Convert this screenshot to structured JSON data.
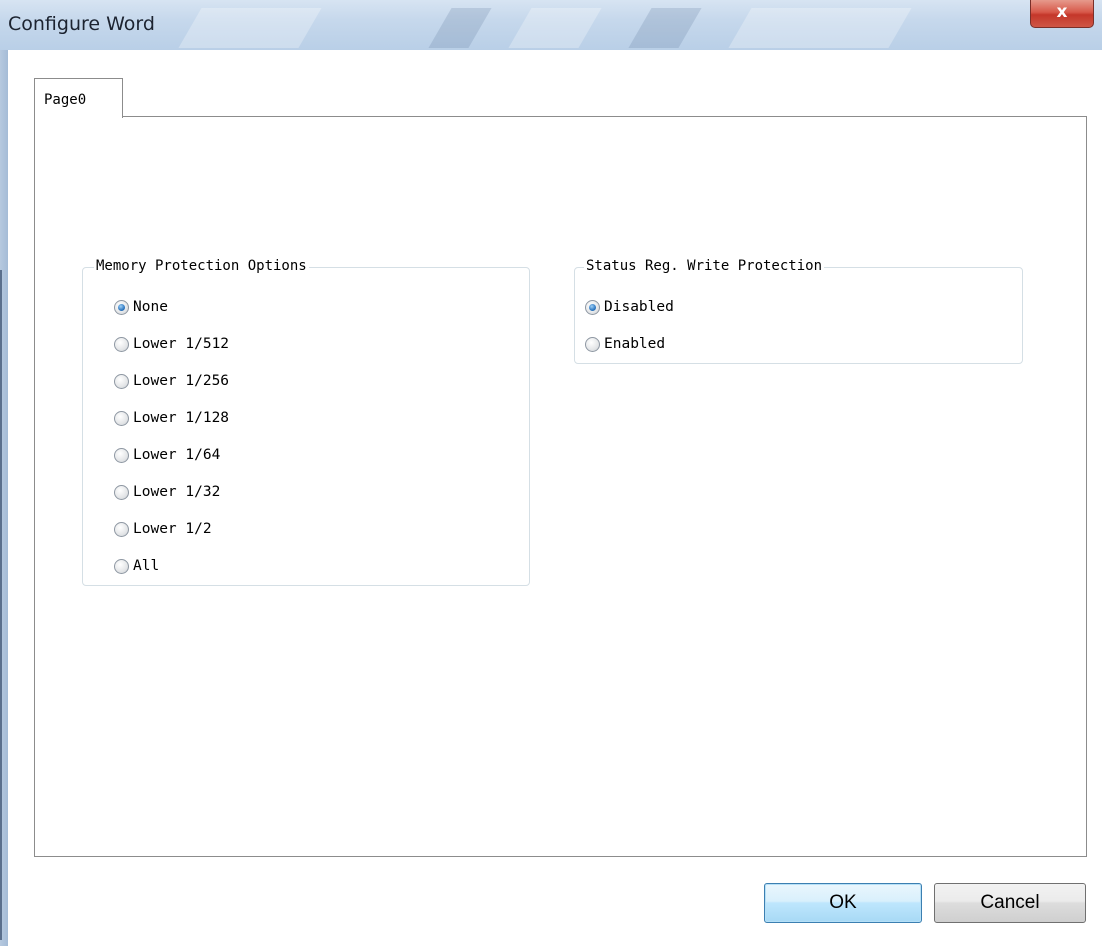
{
  "window": {
    "title": "Configure Word",
    "close_label": "x"
  },
  "tabs": [
    {
      "label": "Page0",
      "selected": true
    }
  ],
  "memory_protection": {
    "legend": "Memory Protection Options",
    "options": [
      {
        "label": "None",
        "checked": true
      },
      {
        "label": "Lower 1/512",
        "checked": false
      },
      {
        "label": "Lower 1/256",
        "checked": false
      },
      {
        "label": "Lower 1/128",
        "checked": false
      },
      {
        "label": "Lower 1/64",
        "checked": false
      },
      {
        "label": "Lower 1/32",
        "checked": false
      },
      {
        "label": "Lower 1/2",
        "checked": false
      },
      {
        "label": "All",
        "checked": false
      }
    ]
  },
  "status_reg_protection": {
    "legend": "Status Reg. Write Protection",
    "options": [
      {
        "label": "Disabled",
        "checked": true
      },
      {
        "label": "Enabled",
        "checked": false
      }
    ]
  },
  "buttons": {
    "ok_label": "OK",
    "cancel_label": "Cancel"
  },
  "colors": {
    "radio_checked": "#2e78c2",
    "close_button": "#c4372a",
    "ok_button_border": "#3c7fb1"
  }
}
